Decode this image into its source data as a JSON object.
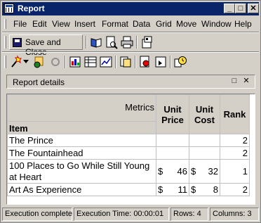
{
  "window": {
    "title": "Report"
  },
  "title_buttons": {
    "minimize": "_",
    "maximize": "□",
    "close": "✕"
  },
  "menu": [
    "File",
    "Edit",
    "View",
    "Insert",
    "Format",
    "Data",
    "Grid",
    "Move",
    "Window",
    "Help"
  ],
  "toolbar": {
    "save_label": "Save and Close"
  },
  "panel": {
    "label": "Report details",
    "restore": "□",
    "close": "✕"
  },
  "grid": {
    "metrics_label": "Metrics",
    "item_label": "Item",
    "columns": [
      {
        "line1": "Unit",
        "line2": "Price"
      },
      {
        "line1": "Unit",
        "line2": "Cost"
      },
      {
        "line1": "Rank",
        "line2": ""
      }
    ],
    "rows": [
      {
        "item": "The Prince",
        "price_sym": "",
        "price": "",
        "cost_sym": "",
        "cost": "",
        "rank": "2"
      },
      {
        "item": "The Fountainhead",
        "price_sym": "",
        "price": "",
        "cost_sym": "",
        "cost": "",
        "rank": "2"
      },
      {
        "item": "100 Places to Go While Still Young at Heart",
        "price_sym": "$",
        "price": "46",
        "cost_sym": "$",
        "cost": "32",
        "rank": "1"
      },
      {
        "item": "Art As Experience",
        "price_sym": "$",
        "price": "11",
        "cost_sym": "$",
        "cost": "8",
        "rank": "2"
      }
    ]
  },
  "status": {
    "state": "Execution complete",
    "time": "Execution Time: 00:00:01",
    "rows": "Rows: 4",
    "columns": "Columns: 3"
  }
}
